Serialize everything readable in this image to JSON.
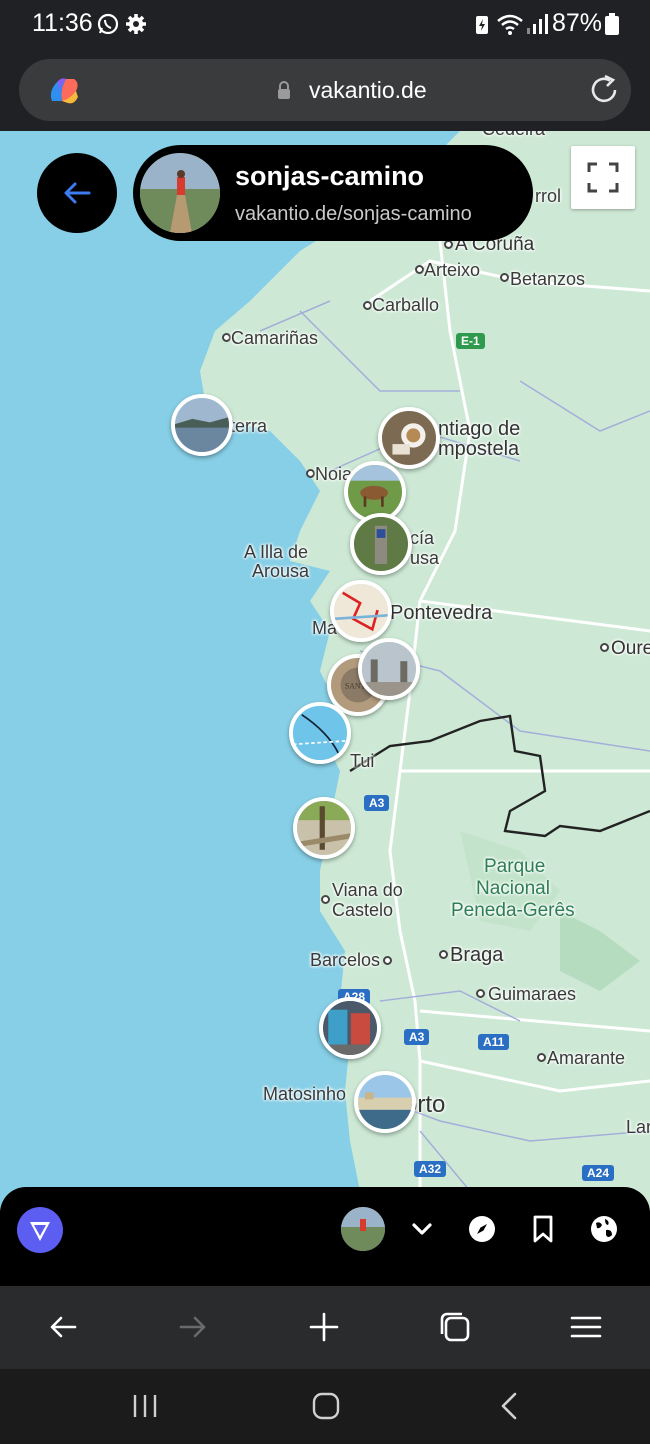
{
  "status_bar": {
    "time": "11:36",
    "battery": "87%",
    "left_icons": [
      "whatsapp-icon",
      "settings-icon"
    ],
    "right_icons": [
      "battery-saver-icon",
      "wifi-icon",
      "signal-icon",
      "battery-icon"
    ]
  },
  "browser": {
    "url": "vakantio.de",
    "left_icon": "copilot-icon",
    "right_icon": "reload-icon"
  },
  "map_header": {
    "title": "sonjas-camino",
    "subtitle": "vakantio.de/sonjas-camino"
  },
  "map": {
    "places": {
      "cedeira": "Cedeira",
      "ferrol": "rrol",
      "a_coruna": "A Coruña",
      "arteixo": "Arteixo",
      "betanzos": "Betanzos",
      "carballo": "Carballo",
      "camarinas": "Camariñas",
      "fisterra": "terra",
      "santiago_1": "ntiago de",
      "santiago_2": "mpostela",
      "noia": "Noia",
      "illa_1": "A Illa de",
      "illa_2": "Arousa",
      "vila_1": "cía",
      "vila_2": "usa",
      "pontevedra": "Pontevedra",
      "marin": "Ma",
      "ourense": "Oure",
      "tui": "Tui",
      "park_1": "Parque",
      "park_2": "Nacional",
      "park_3": "Peneda-Gerês",
      "viana_1": "Viana do",
      "viana_2": "Castelo",
      "barcelos": "Barcelos",
      "braga": "Braga",
      "guimaraes": "Guimaraes",
      "amarante": "Amarante",
      "matosinhos": "Matosinho",
      "porto": "orto",
      "lar": "Lar"
    },
    "highways": {
      "e1": "E-1",
      "a3_north": "A3",
      "a28": "A28",
      "a3_south": "A3",
      "a11": "A11",
      "a32": "A32",
      "a24": "A24"
    },
    "photo_pins": [
      "photo-fisterra",
      "photo-santiago-coffee",
      "photo-horses",
      "photo-waymarker",
      "photo-route-map",
      "photo-stone-marker",
      "photo-church",
      "photo-sea-map",
      "photo-trail",
      "photo-market",
      "photo-porto-river"
    ]
  },
  "app_bar": {
    "icons": [
      "vakantio-logo-icon",
      "chevron-down-icon",
      "compass-icon",
      "bookmark-icon",
      "globe-icon"
    ]
  },
  "browser_nav": {
    "icons": [
      "back-arrow-icon",
      "forward-arrow-icon",
      "new-tab-plus-icon",
      "tabs-icon",
      "menu-icon"
    ]
  },
  "system_nav": {
    "icons": [
      "recent-apps-icon",
      "home-icon",
      "system-back-icon"
    ]
  },
  "colors": {
    "water": "#87cfe6",
    "land": "#cde9d5",
    "accent": "#5b5ef0",
    "back_arrow": "#3d7bf0"
  }
}
